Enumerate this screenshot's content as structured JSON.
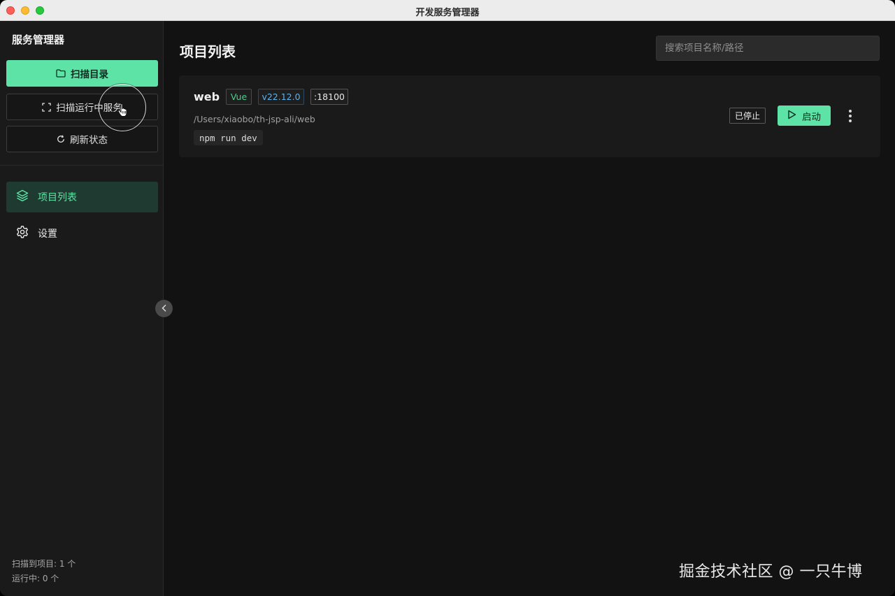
{
  "window": {
    "title": "开发服务管理器"
  },
  "sidebar": {
    "app_name": "服务管理器",
    "buttons": {
      "scan_dir": "扫描目录",
      "scan_running": "扫描运行中服务",
      "refresh": "刷新状态"
    },
    "nav": [
      {
        "label": "项目列表",
        "icon": "layers-icon",
        "active": true
      },
      {
        "label": "设置",
        "icon": "gear-icon",
        "active": false
      }
    ],
    "stats": {
      "scanned": "扫描到项目: 1 个",
      "running": "运行中: 0 个"
    }
  },
  "main": {
    "title": "项目列表",
    "search": {
      "placeholder": "搜索项目名称/路径",
      "value": ""
    },
    "projects": [
      {
        "name": "web",
        "framework": "Vue",
        "node_version": "v22.12.0",
        "port": ":18100",
        "path": "/Users/xiaobo/th-jsp-ali/web",
        "command": "npm run dev",
        "status": "已停止",
        "action_label": "启动"
      }
    ]
  },
  "watermark": "掘金技术社区 @ 一只牛博",
  "colors": {
    "accent": "#5ee3a6",
    "background": "#121212",
    "sidebar": "#1a1a1a",
    "framework_tag": "#4ad08c",
    "node_tag": "#58b3ef"
  }
}
